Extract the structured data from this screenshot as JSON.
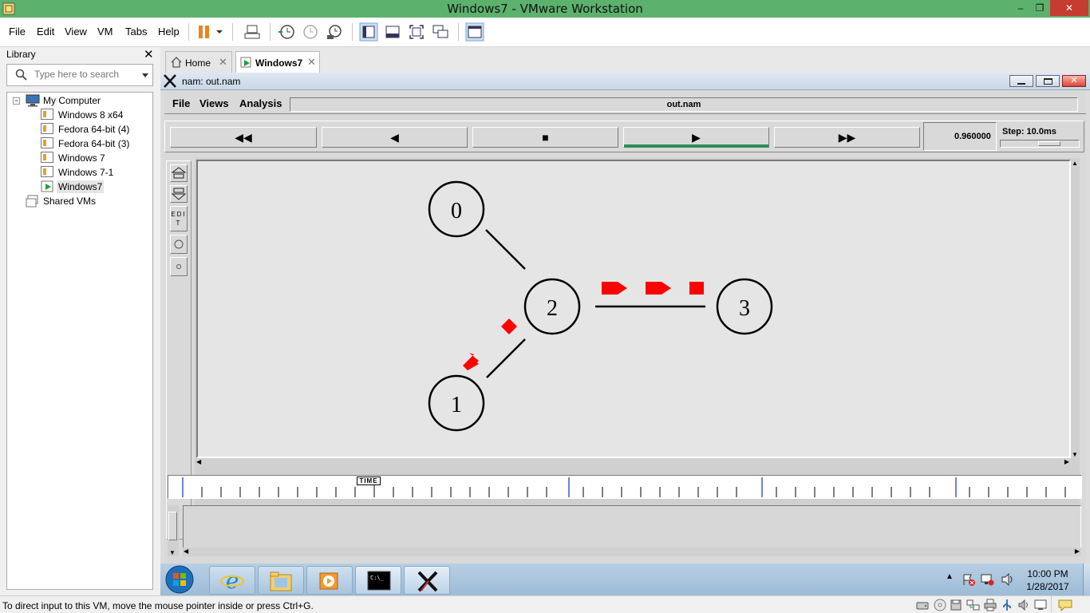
{
  "window": {
    "title": "Windows7 - VMware Workstation",
    "minimize": "–",
    "maximize": "❐",
    "close": "✕"
  },
  "menu": [
    "File",
    "Edit",
    "View",
    "VM",
    "Tabs",
    "Help"
  ],
  "library": {
    "title": "Library",
    "close": "✕",
    "search_placeholder": "Type here to search",
    "tree": {
      "root": "My Computer",
      "vms": [
        "Windows 8 x64",
        "Fedora 64-bit (4)",
        "Fedora 64-bit (3)",
        "Windows 7",
        "Windows 7-1",
        "Windows7"
      ],
      "shared": "Shared VMs"
    }
  },
  "tabs": [
    {
      "label": "Home",
      "close": "✕"
    },
    {
      "label": "Windows7",
      "close": "✕"
    }
  ],
  "nam": {
    "window_title": "nam: out.nam",
    "menus": [
      "File",
      "Views",
      "Analysis"
    ],
    "file_name": "out.nam",
    "time": "0.960000",
    "step": "Step: 10.0ms",
    "edit_label": "EDIT",
    "timeline_label": "TIME",
    "nodes": [
      "0",
      "1",
      "2",
      "3"
    ]
  },
  "taskbar": {
    "time": "10:00 PM",
    "date": "1/28/2017"
  },
  "status": "To direct input to this VM, move the mouse pointer inside or press Ctrl+G.",
  "colors": {
    "titlebar": "#5cb26d",
    "packet": "#ff0000",
    "play_indicator": "#2e8b57"
  }
}
